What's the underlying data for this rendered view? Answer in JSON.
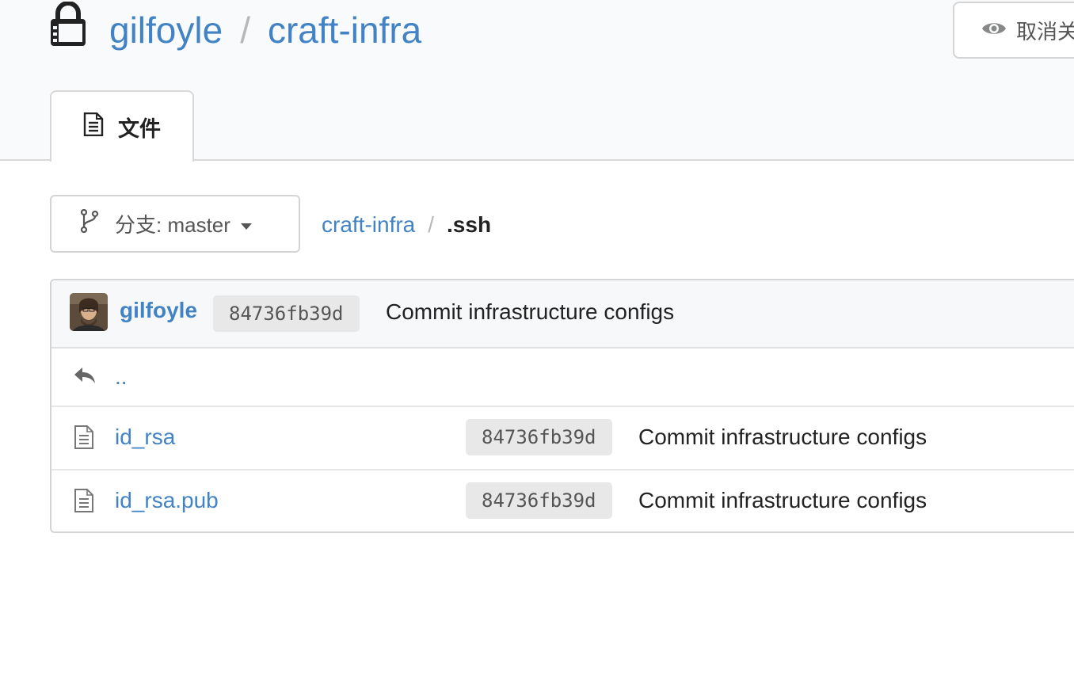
{
  "repo": {
    "owner": "gilfoyle",
    "separator": "/",
    "name": "craft-infra"
  },
  "header": {
    "watch_label": "取消关注"
  },
  "tabs": [
    {
      "label": "文件"
    }
  ],
  "toolbar": {
    "branch_label": "分支: master"
  },
  "breadcrumb": {
    "root": "craft-infra",
    "separator": "/",
    "current": ".ssh"
  },
  "latest_commit": {
    "author": "gilfoyle",
    "sha": "84736fb39d",
    "message": "Commit infrastructure configs"
  },
  "files": [
    {
      "name": "..",
      "type": "parent"
    },
    {
      "name": "id_rsa",
      "type": "file",
      "sha": "84736fb39d",
      "message": "Commit infrastructure configs"
    },
    {
      "name": "id_rsa.pub",
      "type": "file",
      "sha": "84736fb39d",
      "message": "Commit infrastructure configs"
    }
  ],
  "icons": {
    "repo": "lock-icon",
    "watch": "eye-icon",
    "files_tab": "file-text-icon",
    "branch": "branch-icon",
    "parent": "reply-icon",
    "file": "file-icon"
  },
  "colors": {
    "link": "#4183c4",
    "header_bg": "#f9fafb",
    "badge_bg": "#e8e8e8"
  }
}
